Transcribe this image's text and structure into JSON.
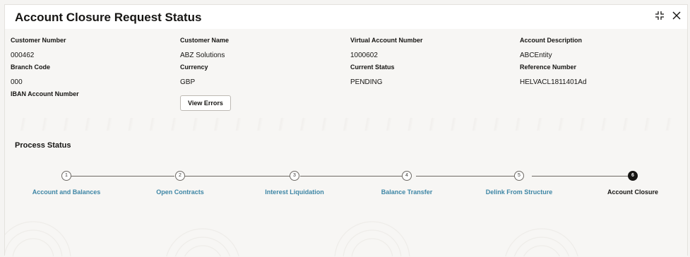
{
  "window": {
    "title": "Account Closure Request Status",
    "actions": [
      {
        "name": "maximize-icon"
      },
      {
        "name": "close-icon"
      }
    ]
  },
  "fields": {
    "customer_number": {
      "label": "Customer Number",
      "value": "000462"
    },
    "customer_name": {
      "label": "Customer Name",
      "value": "ABZ Solutions"
    },
    "virtual_account_number": {
      "label": "Virtual Account Number",
      "value": "1000602"
    },
    "account_description": {
      "label": "Account Description",
      "value": "ABCEntity"
    },
    "branch_code": {
      "label": "Branch Code",
      "value": "000"
    },
    "currency": {
      "label": "Currency",
      "value": "GBP"
    },
    "current_status": {
      "label": "Current Status",
      "value": "PENDING"
    },
    "reference_number": {
      "label": "Reference Number",
      "value": "HELVACL1811401Ad"
    },
    "iban_account_number": {
      "label": "IBAN Account Number",
      "value": ""
    }
  },
  "view_errors_label": "View Errors",
  "process": {
    "title": "Process Status",
    "steps": [
      {
        "num": "1",
        "label": "Account and Balances",
        "active": false
      },
      {
        "num": "2",
        "label": "Open Contracts",
        "active": false
      },
      {
        "num": "3",
        "label": "Interest Liquidation",
        "active": false
      },
      {
        "num": "4",
        "label": "Balance Transfer",
        "active": false
      },
      {
        "num": "5",
        "label": "Delink From Structure",
        "active": false
      },
      {
        "num": "6",
        "label": "Account Closure",
        "active": true
      }
    ]
  },
  "colors": {
    "link": "#3e86a5",
    "text": "#161513",
    "background": "#f7f6f4"
  }
}
